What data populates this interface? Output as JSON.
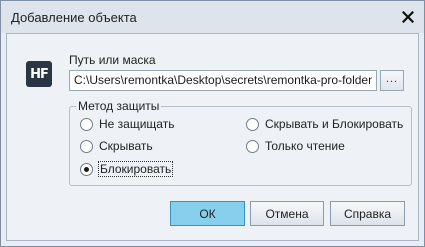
{
  "window": {
    "title": "Добавление объекта",
    "close_glyph": "✕"
  },
  "app_icon": {
    "text": "HF"
  },
  "path": {
    "label": "Путь или маска",
    "value": "C:\\Users\\remontka\\Desktop\\secrets\\remontka-pro-folder",
    "browse_label": "..."
  },
  "protection": {
    "legend": "Метод защиты",
    "options": [
      {
        "label": "Не защищать",
        "checked": false
      },
      {
        "label": "Скрывать",
        "checked": false
      },
      {
        "label": "Блокировать",
        "checked": true
      },
      {
        "label": "Скрывать и Блокировать",
        "checked": false
      },
      {
        "label": "Только чтение",
        "checked": false
      }
    ]
  },
  "buttons": {
    "ok": "ОК",
    "cancel": "Отмена",
    "help": "Справка"
  },
  "colors": {
    "ok_button": "#86d0ee",
    "window_bg": "#e8edf3"
  }
}
